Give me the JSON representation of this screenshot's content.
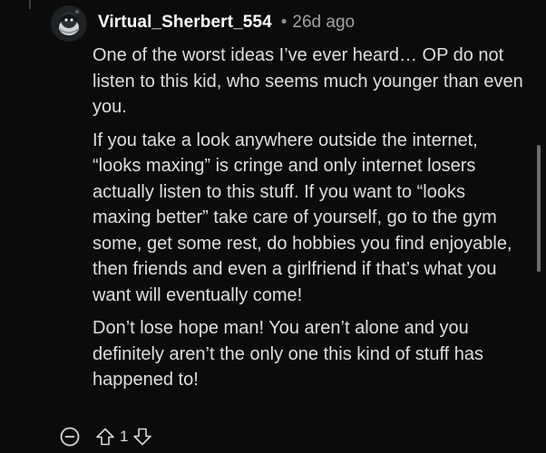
{
  "comment": {
    "username": "Virtual_Sherbert_554",
    "separator": "•",
    "age": "26d ago",
    "paragraphs": [
      "One of the worst ideas I’ve ever heard… OP do not listen to this kid, who seems much younger than even you.",
      "If you take a look anywhere outside the internet, “looks maxing” is cringe and only internet losers actually listen to this stuff. If you want to “looks maxing better” take care of yourself, go to the gym some, get some rest, do hobbies you find enjoyable, then friends and even a girlfriend if that’s what you want will eventually come!",
      "Don’t lose hope man! You aren’t alone and you definitely aren’t the only one this kind of stuff has happened to!"
    ],
    "score": "1"
  },
  "icons": {
    "avatar": "snoo-avatar",
    "collapse": "collapse-minus-icon",
    "upvote": "upvote-arrow-icon",
    "downvote": "downvote-arrow-icon"
  }
}
